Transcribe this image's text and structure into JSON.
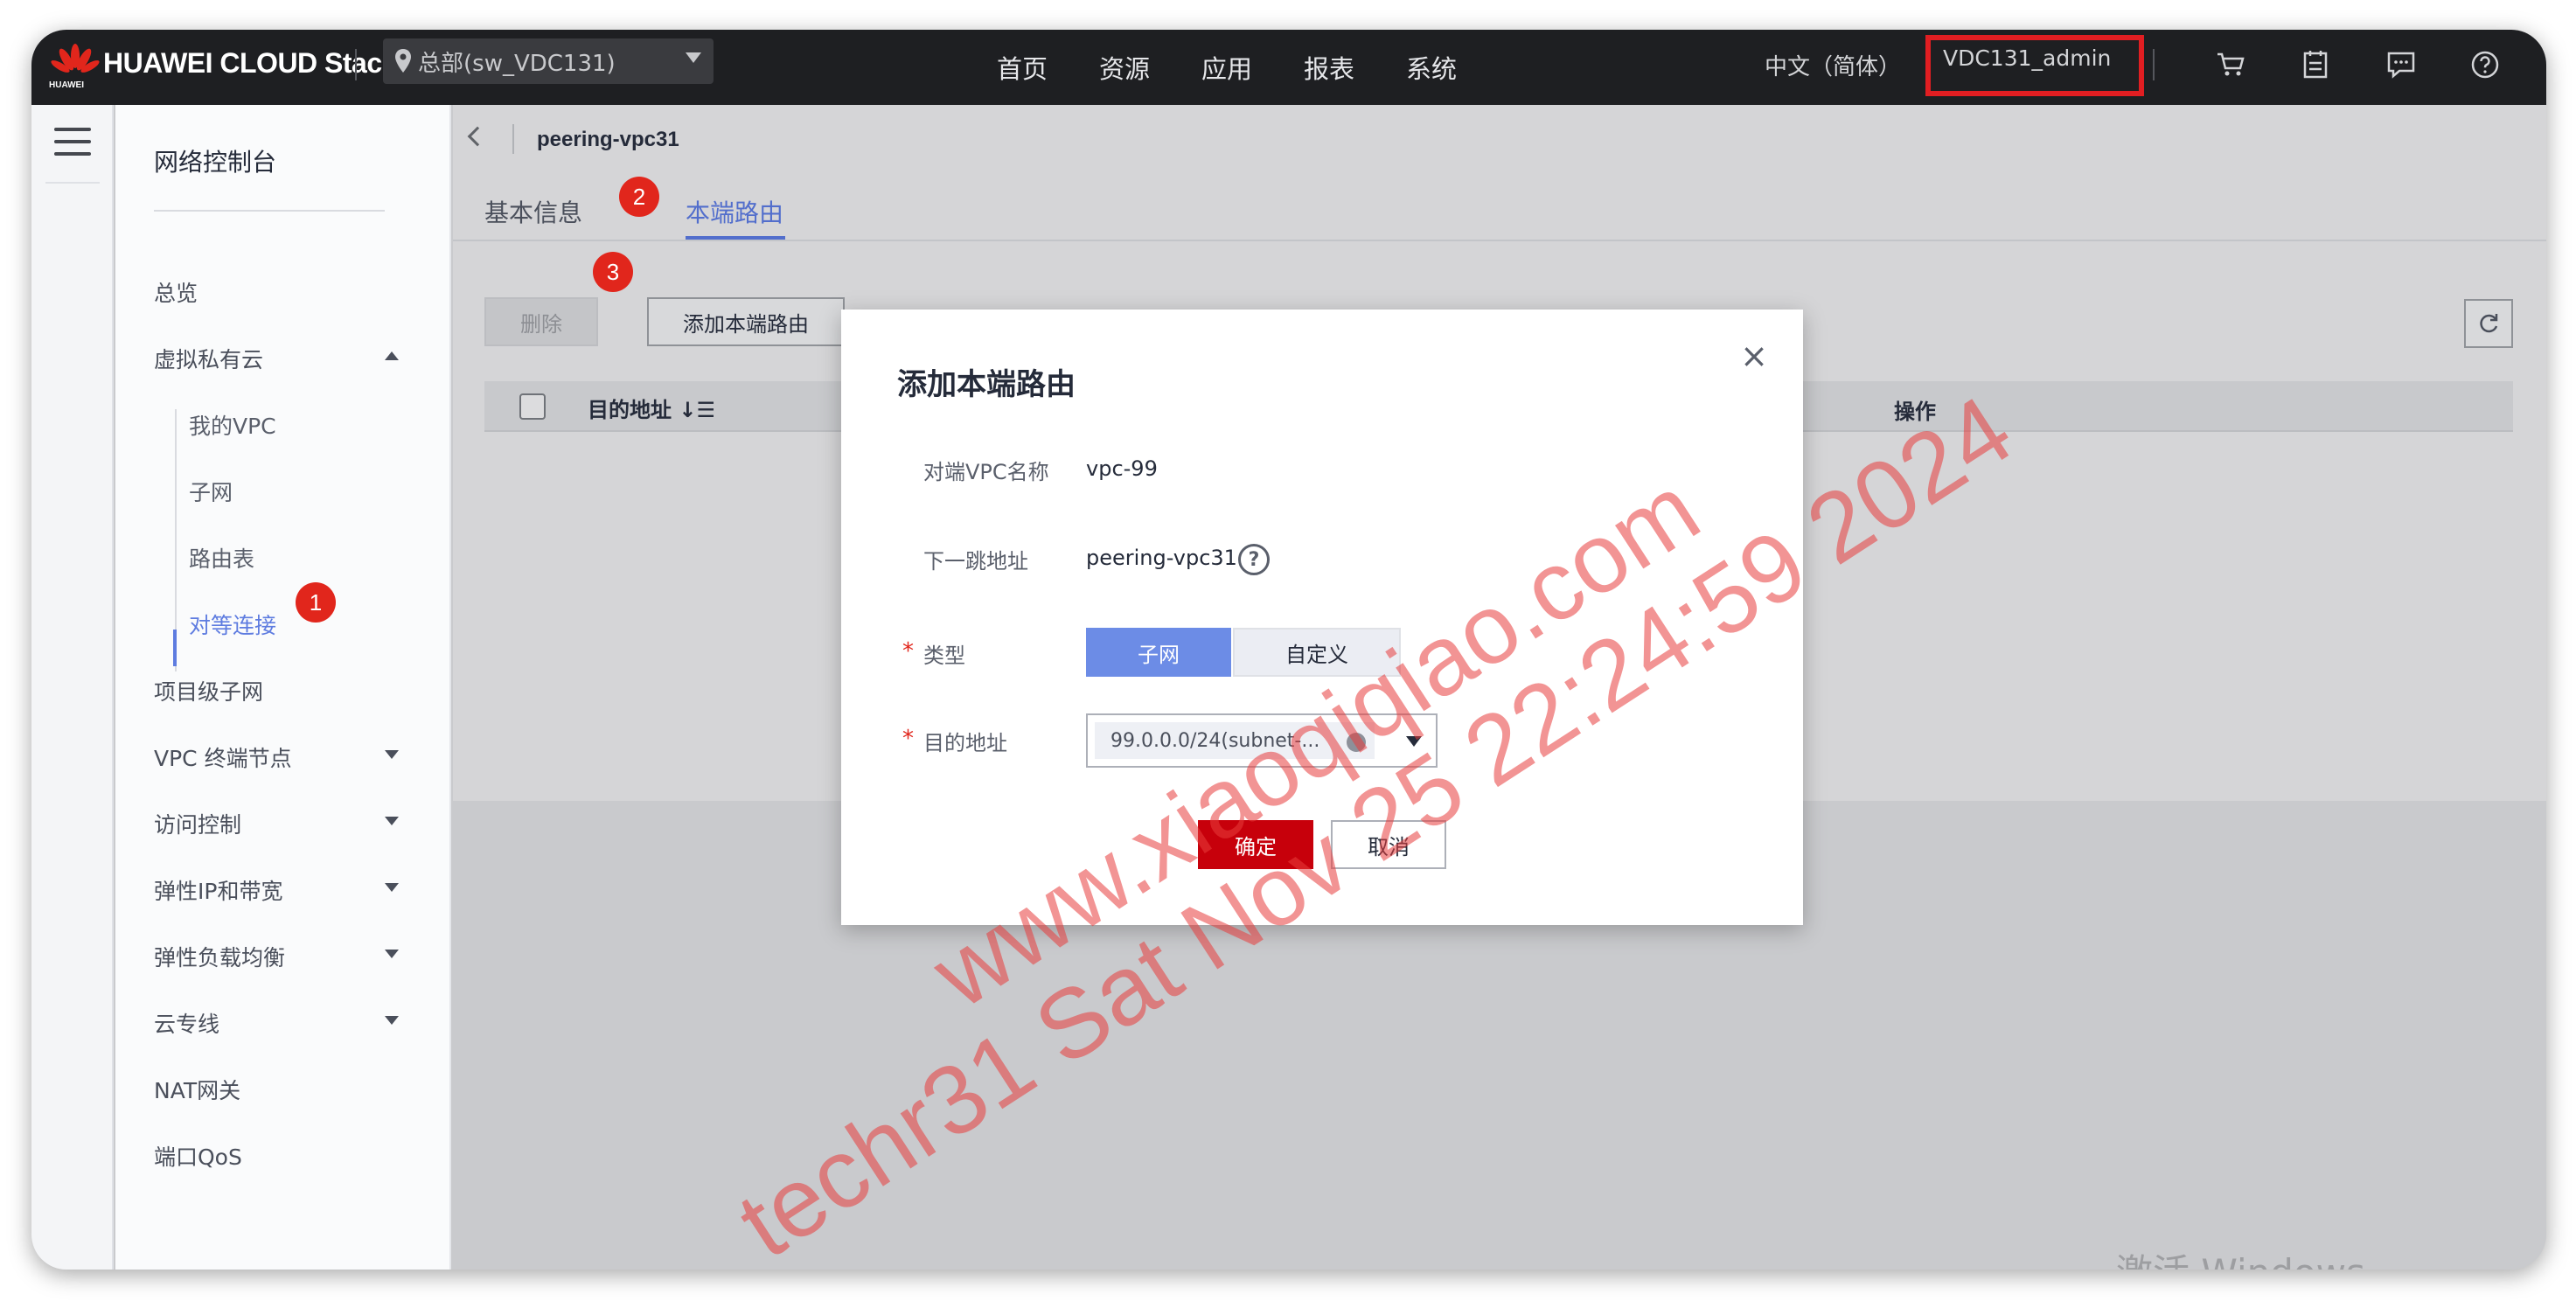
{
  "topbar": {
    "logo_text": "HUAWEI CLOUD Stack",
    "logo_sub": "HUAWEI",
    "region": "总部(sw_VDC131)",
    "nav": [
      "首页",
      "资源",
      "应用",
      "报表",
      "系统"
    ],
    "language": "中文（简体）",
    "user": "VDC131_admin",
    "icons": [
      "cart-icon",
      "calendar-icon",
      "message-icon",
      "help-icon"
    ]
  },
  "sidebar": {
    "title": "网络控制台",
    "items": [
      {
        "label": "总览"
      },
      {
        "label": "虚拟私有云",
        "expanded": true
      },
      {
        "label": "我的VPC"
      },
      {
        "label": "子网"
      },
      {
        "label": "路由表"
      },
      {
        "label": "对等连接",
        "active": true
      },
      {
        "label": "项目级子网"
      },
      {
        "label": "VPC 终端节点"
      },
      {
        "label": "访问控制"
      },
      {
        "label": "弹性IP和带宽"
      },
      {
        "label": "弹性负载均衡"
      },
      {
        "label": "云专线"
      },
      {
        "label": "NAT网关"
      },
      {
        "label": "端口QoS"
      }
    ]
  },
  "main": {
    "breadcrumb": "peering-vpc31",
    "tabs": [
      {
        "label": "基本信息"
      },
      {
        "label": "本端路由",
        "active": true
      }
    ],
    "delete_button": "删除",
    "add_button": "添加本端路由",
    "table": {
      "columns": [
        "目的地址 ↓☰",
        "操作"
      ]
    }
  },
  "steps": [
    "1",
    "2",
    "3"
  ],
  "modal": {
    "title": "添加本端路由",
    "close": "×",
    "fields": {
      "peer_vpc_label": "对端VPC名称",
      "peer_vpc_value": "vpc-99",
      "next_hop_label": "下一跳地址",
      "next_hop_value": "peering-vpc31",
      "help": "?",
      "type_label": "类型",
      "type_options": [
        "子网",
        "自定义"
      ],
      "type_selected": "子网",
      "dest_label": "目的地址",
      "dest_value": "99.0.0.0/24(subnet-..."
    },
    "required_mark": "*",
    "ok_button": "确定",
    "cancel_button": "取消"
  },
  "watermark": {
    "line1": "www.xiaoqiqiao.com",
    "line2": "techr31 Sat Nov 25 22:24:59 2024"
  },
  "os_activation": "激活 Windows",
  "colors": {
    "accent": "#526ecc",
    "primary_button": "#c7000b",
    "highlight_box": "#e11e22",
    "badge": "#e1261c"
  }
}
